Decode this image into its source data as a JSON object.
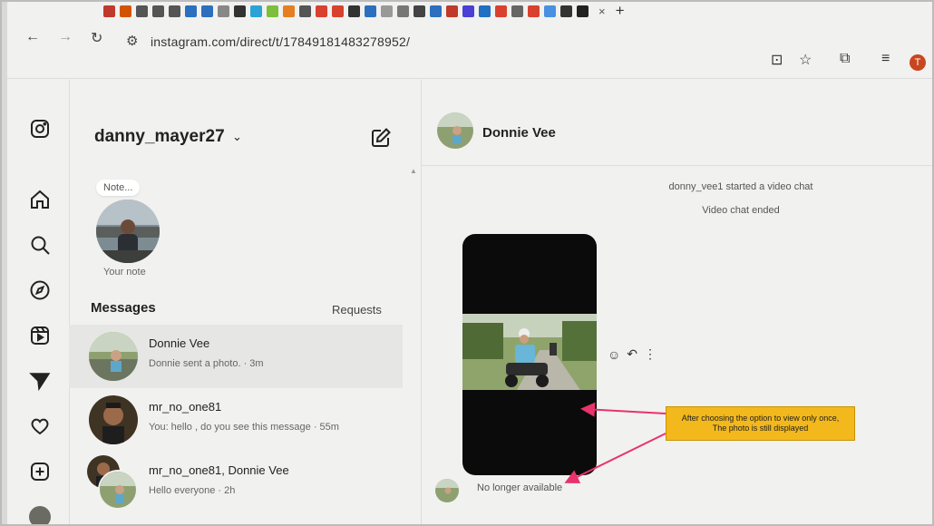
{
  "browser": {
    "url": "instagram.com/direct/t/17849181483278952/",
    "profile_initial": "T",
    "tab_colors": [
      "#c0392b",
      "#d35400",
      "#555",
      "#555",
      "#555",
      "#2c6fbf",
      "#2c6fbf",
      "#888",
      "#333",
      "#2ba3d6",
      "#7bbf3a",
      "#e67e22",
      "#555",
      "#d9412f",
      "#d9412f",
      "#333",
      "#2c6fbf",
      "#999",
      "#777",
      "#444",
      "#2c6fbf",
      "#c0392b",
      "#4b3fd6",
      "#1f6fc2",
      "#d9412f",
      "#666",
      "#d9412f",
      "#4a90e2",
      "#333",
      "#222"
    ]
  },
  "sidebar": {
    "icons": [
      "instagram-logo-icon",
      "home-icon",
      "search-icon",
      "explore-icon",
      "reels-icon",
      "messages-icon",
      "notifications-icon",
      "create-icon"
    ]
  },
  "inbox": {
    "username": "danny_mayer27",
    "note_bubble": "Note...",
    "your_note": "Your note",
    "messages_heading": "Messages",
    "requests_label": "Requests",
    "threads": [
      {
        "name": "Donnie Vee",
        "preview": "Donnie sent a photo. · 3m"
      },
      {
        "name": "mr_no_one81",
        "preview": "You: hello , do you see this message · 55m"
      },
      {
        "name": "mr_no_one81, Donnie Vee",
        "preview": "Hello everyone · 2h"
      }
    ]
  },
  "chat": {
    "contact_name": "Donnie Vee",
    "system_1": "donny_vee1 started a video chat",
    "system_2": "Video chat ended",
    "no_longer_available": "No longer available"
  },
  "annotation": {
    "line1": "After choosing the option to view only once,",
    "line2": "The photo is still displayed",
    "color": "#f3b81c",
    "arrow_color": "#e8336b"
  }
}
